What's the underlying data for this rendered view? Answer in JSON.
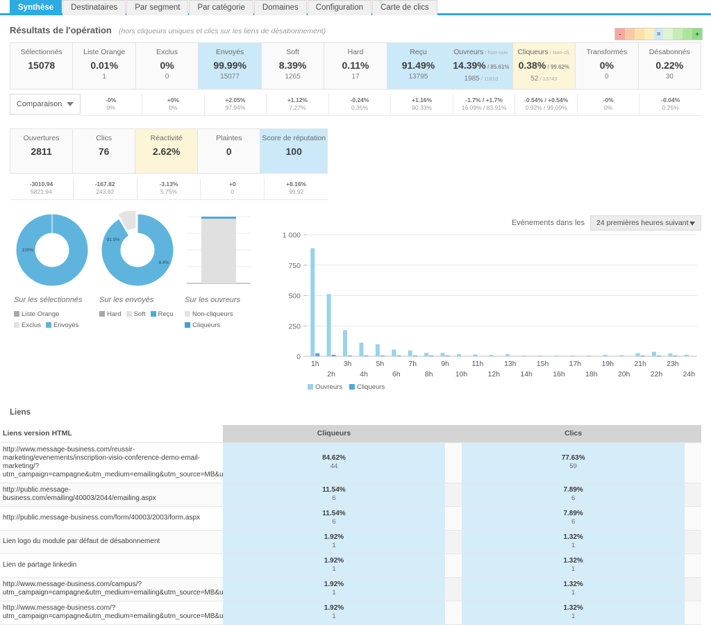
{
  "tabs": [
    {
      "label": "Synthèse",
      "active": true
    },
    {
      "label": "Destinataires",
      "active": false
    },
    {
      "label": "Par segment",
      "active": false
    },
    {
      "label": "Par catégorie",
      "active": false
    },
    {
      "label": "Domaines",
      "active": false
    },
    {
      "label": "Configuration",
      "active": false
    },
    {
      "label": "Carte de clics",
      "active": false
    }
  ],
  "section": {
    "title": "Résultats de l'opération",
    "subtitle": "(hors cliqueurs uniques et clics sur les liens de désabonnement)"
  },
  "gradient_legend": {
    "minus": "-",
    "equals": "=",
    "plus": "+",
    "colors": [
      "#f7a9a0",
      "#fbc8a4",
      "#fde0a8",
      "#fdf0b4",
      "#cde9f7",
      "#ddf3d2",
      "#c4ecb4",
      "#abe59b",
      "#8edc85"
    ]
  },
  "stats_row1": [
    {
      "label": "Sélectionnés",
      "sub_label": "",
      "value": "15078",
      "value_sub": "",
      "count": "",
      "count_sub": "",
      "highlight": "none",
      "cmp1": "-0%",
      "cmp2": "0%",
      "first": true
    },
    {
      "label": "Liste Orange",
      "sub_label": "",
      "value": "0.01%",
      "value_sub": "",
      "count": "1",
      "count_sub": "",
      "highlight": "none",
      "cmp1": "-0%",
      "cmp2": "0%"
    },
    {
      "label": "Exclus",
      "sub_label": "",
      "value": "0%",
      "value_sub": "",
      "count": "0",
      "count_sub": "",
      "highlight": "none",
      "cmp1": "+0%",
      "cmp2": "0%"
    },
    {
      "label": "Envoyés",
      "sub_label": "",
      "value": "99.99%",
      "value_sub": "",
      "count": "15077",
      "count_sub": "",
      "highlight": "blue",
      "cmp1": "+2.05%",
      "cmp2": "97.94%"
    },
    {
      "label": "Soft",
      "sub_label": "",
      "value": "8.39%",
      "value_sub": "",
      "count": "1265",
      "count_sub": "",
      "highlight": "none",
      "cmp1": "+1.12%",
      "cmp2": "7.27%"
    },
    {
      "label": "Hard",
      "sub_label": "",
      "value": "0.11%",
      "value_sub": "",
      "count": "17",
      "count_sub": "",
      "highlight": "none",
      "cmp1": "-0.24%",
      "cmp2": "0.35%"
    },
    {
      "label": "Reçu",
      "sub_label": "",
      "value": "91.49%",
      "value_sub": "",
      "count": "13795",
      "count_sub": "",
      "highlight": "blue",
      "cmp1": "+1.16%",
      "cmp2": "90.33%"
    },
    {
      "label": "Ouvreurs",
      "sub_label": "/ Non-ouv.",
      "value": "14.39%",
      "value_sub": "/ 85.61%",
      "count": "1985",
      "count_sub": "/ 11810",
      "highlight": "blue",
      "cmp1": "-1.7% / +1.7%",
      "cmp2": "16.09% / 83.91%"
    },
    {
      "label": "Cliqueurs",
      "sub_label": "/ Non-cli.",
      "value": "0.38%",
      "value_sub": "/ 99.62%",
      "count": "52",
      "count_sub": "/ 13743",
      "highlight": "yellow",
      "cmp1": "-0.54% / +0.54%",
      "cmp2": "0.92% / 99.09%"
    },
    {
      "label": "Transformés",
      "sub_label": "",
      "value": "0%",
      "value_sub": "",
      "count": "0",
      "count_sub": "",
      "highlight": "none",
      "cmp1": "-0%",
      "cmp2": "0%"
    },
    {
      "label": "Désabonnés",
      "sub_label": "",
      "value": "0.22%",
      "value_sub": "",
      "count": "30",
      "count_sub": "",
      "highlight": "none",
      "cmp1": "-0.04%",
      "cmp2": "0.25%"
    }
  ],
  "comparison_label": "Comparaison",
  "stats_row2": [
    {
      "label": "Ouvertures",
      "value": "2811",
      "highlight": "none",
      "cmp1": "-3010.94",
      "cmp2": "5821.94"
    },
    {
      "label": "Clics",
      "value": "76",
      "highlight": "none",
      "cmp1": "-167.82",
      "cmp2": "243.82"
    },
    {
      "label": "Réactivité",
      "value": "2.62%",
      "highlight": "yellow",
      "cmp1": "-3.13%",
      "cmp2": "5.75%"
    },
    {
      "label": "Plaintes",
      "value": "0",
      "highlight": "none",
      "cmp1": "+0",
      "cmp2": "0"
    },
    {
      "label": "Score de réputation",
      "value": "100",
      "highlight": "blue",
      "cmp1": "+8.16%",
      "cmp2": "99.92"
    }
  ],
  "events": {
    "caption": "Evénements dans les",
    "selected": "24 premières heures suivant"
  },
  "chart_data": [
    {
      "type": "pie",
      "title": "Sur les sélectionnés",
      "labels": [
        "Envoyés",
        "Liste Orange",
        "Exclus"
      ],
      "values": [
        99.99,
        0.01,
        0
      ],
      "data_labels": [
        "100%"
      ],
      "colors": [
        "#5fb4dd",
        "#a8a8a8",
        "#e0e0e0"
      ],
      "legend": [
        {
          "label": "Liste Orange",
          "color": "#a8a8a8"
        },
        {
          "label": "Exclus",
          "color": "#e3e3e3"
        },
        {
          "label": "Envoyés",
          "color": "#5fb4dd"
        }
      ]
    },
    {
      "type": "pie",
      "title": "Sur les envoyés",
      "labels": [
        "Reçu",
        "Soft",
        "Hard"
      ],
      "values": [
        91.5,
        8.4,
        0.1
      ],
      "data_labels": [
        "91.5%",
        "8.4%"
      ],
      "colors": [
        "#5fb4dd",
        "#e3e3e3",
        "#a8a8a8"
      ],
      "legend": [
        {
          "label": "Hard",
          "color": "#a8a8a8"
        },
        {
          "label": "Soft",
          "color": "#e3e3e3"
        },
        {
          "label": "Reçu",
          "color": "#4ea9d8"
        }
      ]
    },
    {
      "type": "bar",
      "title": "Sur les ouvreurs",
      "categories": [
        "Ouvreurs"
      ],
      "series": [
        {
          "name": "Non-cliqueurs",
          "values": [
            97.4
          ],
          "color": "#e0e0e0"
        },
        {
          "name": "Cliqueurs",
          "values": [
            2.6
          ],
          "color": "#4ea9d8"
        }
      ],
      "stacked": true,
      "legend": [
        {
          "label": "Non-cliqueurs",
          "color": "#e3e3e3"
        },
        {
          "label": "Cliqueurs",
          "color": "#3fa3d6"
        }
      ]
    },
    {
      "type": "bar",
      "title": "",
      "xlabel": "",
      "ylabel": "",
      "ylim": [
        0,
        1000
      ],
      "yticks": [
        0,
        250,
        500,
        750,
        1000
      ],
      "ytick_labels": [
        "0",
        "250",
        "500",
        "750",
        "1 000"
      ],
      "categories": [
        "1h",
        "2h",
        "3h",
        "4h",
        "5h",
        "6h",
        "7h",
        "8h",
        "9h",
        "10h",
        "11h",
        "12h",
        "13h",
        "14h",
        "15h",
        "16h",
        "17h",
        "18h",
        "19h",
        "20h",
        "21h",
        "22h",
        "23h",
        "24h"
      ],
      "series": [
        {
          "name": "Ouvreurs",
          "color": "#9ad2ec",
          "values": [
            890,
            512,
            215,
            112,
            98,
            55,
            48,
            28,
            27,
            18,
            15,
            11,
            18,
            4,
            3,
            3,
            2,
            4,
            12,
            8,
            26,
            36,
            24,
            13
          ]
        },
        {
          "name": "Cliqueurs",
          "color": "#4ea9d8",
          "values": [
            25,
            12,
            5,
            3,
            2,
            1,
            1,
            1,
            1,
            0,
            0,
            0,
            0,
            0,
            0,
            0,
            0,
            0,
            0,
            0,
            1,
            1,
            1,
            0
          ]
        }
      ],
      "legend_position": "bottom",
      "grid": true
    }
  ],
  "liens": {
    "title": "Liens",
    "col_url": "Liens version HTML",
    "col_cliqueurs": "Cliqueurs",
    "col_clics": "Clics",
    "rows": [
      {
        "url": "http://www.message-business.com/reussir-marketing/evenements/inscription-visio-conference-demo-email-marketing/?utm_campaign=campagne&utm_medium=emailing&utm_source=MB&utm_term=Message+Business",
        "cliqueurs_pct": "84.62%",
        "cliqueurs_n": "44",
        "clics_pct": "77.63%",
        "clics_n": "59"
      },
      {
        "url": "http://public.message-business.com/emailing/40003/2044/emailing.aspx",
        "cliqueurs_pct": "11.54%",
        "cliqueurs_n": "6",
        "clics_pct": "7.89%",
        "clics_n": "6"
      },
      {
        "url": "http://public.message-business.com/form/40003/2003/form.aspx",
        "cliqueurs_pct": "11.54%",
        "cliqueurs_n": "6",
        "clics_pct": "7.89%",
        "clics_n": "6"
      },
      {
        "url": "Lien logo du module par défaut de désabonnement",
        "cliqueurs_pct": "1.92%",
        "cliqueurs_n": "1",
        "clics_pct": "1.32%",
        "clics_n": "1"
      },
      {
        "url": "Lien de partage linkedin",
        "cliqueurs_pct": "1.92%",
        "cliqueurs_n": "1",
        "clics_pct": "1.32%",
        "clics_n": "1"
      },
      {
        "url": "http://www.message-business.com/campus/?utm_campaign=campagne&utm_medium=emailing&utm_source=MB&utm_term=Message+Business",
        "cliqueurs_pct": "1.92%",
        "cliqueurs_n": "1",
        "clics_pct": "1.32%",
        "clics_n": "1"
      },
      {
        "url": "http://www.message-business.com/?utm_campaign=campagne&utm_medium=emailing&utm_source=MB&utm_term=Message+Business",
        "cliqueurs_pct": "1.92%",
        "cliqueurs_n": "1",
        "clics_pct": "1.32%",
        "clics_n": "1"
      }
    ]
  }
}
